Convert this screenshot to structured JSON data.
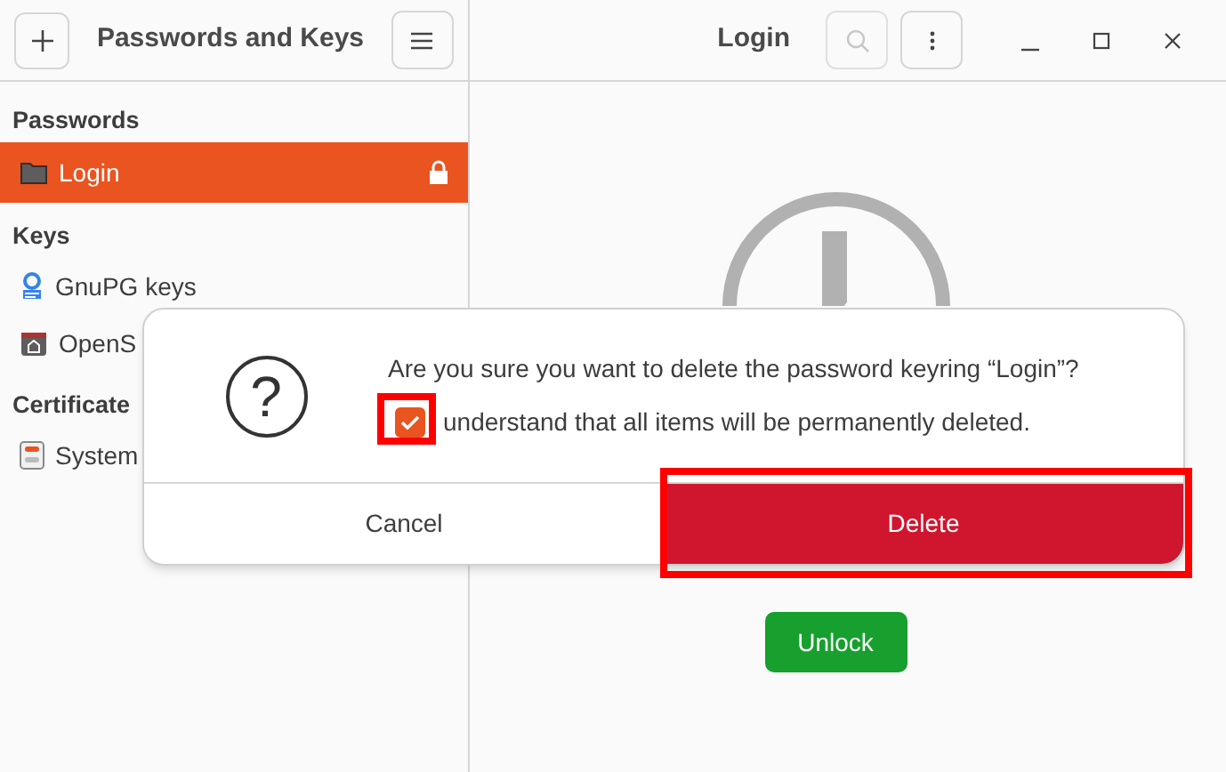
{
  "header": {
    "title": "Passwords and Keys",
    "main_title": "Login"
  },
  "sidebar": {
    "sections": [
      {
        "title": "Passwords",
        "items": [
          {
            "label": "Login",
            "kind": "folder",
            "selected": true,
            "locked": true
          }
        ]
      },
      {
        "title": "Keys",
        "items": [
          {
            "label": "GnuPG keys",
            "kind": "gpg",
            "selected": false,
            "locked": false
          },
          {
            "label": "OpenS",
            "kind": "ssh",
            "selected": false,
            "locked": false
          }
        ]
      },
      {
        "title": "Certificate",
        "items": [
          {
            "label": "System",
            "kind": "cert",
            "selected": false,
            "locked": false
          }
        ]
      }
    ]
  },
  "dialog": {
    "icon_glyph": "?",
    "message": "Are you sure you want to delete the password keyring “Login”?",
    "checkbox": {
      "label": "understand that all items will be permanently deleted.",
      "checked": true,
      "highlighted": true
    },
    "buttons": [
      {
        "label": "Cancel",
        "kind": "cancel",
        "highlighted": false
      },
      {
        "label": "Delete",
        "kind": "destructive",
        "highlighted": true
      }
    ]
  },
  "unlock_button": {
    "label": "Unlock"
  }
}
